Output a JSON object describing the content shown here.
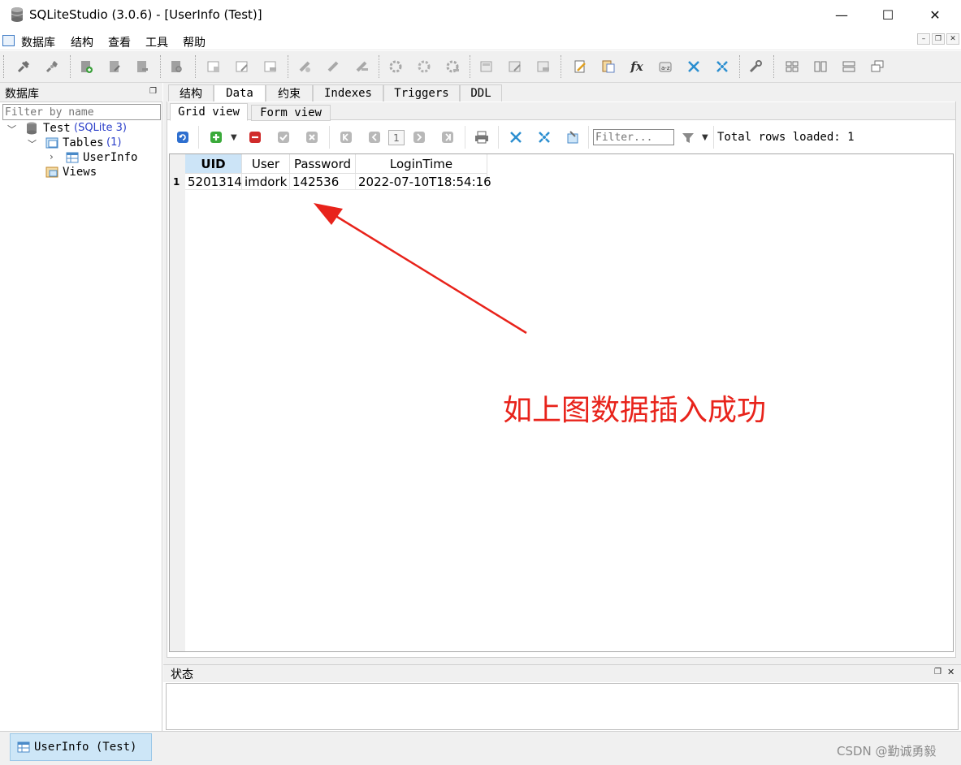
{
  "window": {
    "title": "SQLiteStudio (3.0.6) - [UserInfo (Test)]",
    "minimize": "—",
    "maximize": "☐",
    "close": "✕"
  },
  "menu": [
    "数据库",
    "结构",
    "查看",
    "工具",
    "帮助"
  ],
  "db_panel": {
    "title": "数据库",
    "filter_placeholder": "Filter by name",
    "tree": {
      "db_name": "Test",
      "db_type": "(SQLite 3)",
      "tables_label": "Tables",
      "tables_count": "(1)",
      "table_name": "UserInfo",
      "views_label": "Views"
    }
  },
  "tabs": [
    "结构",
    "Data",
    "约束",
    "Indexes",
    "Triggers",
    "DDL"
  ],
  "active_tab": "Data",
  "subtabs": [
    "Grid view",
    "Form view"
  ],
  "grid_toolbar": {
    "page_number": "1",
    "filter_placeholder": "Filter...",
    "total_rows": "Total rows loaded: 1"
  },
  "grid": {
    "columns": [
      "UID",
      "User",
      "Password",
      "LoginTime"
    ],
    "rows": [
      {
        "num": "1",
        "cells": [
          "5201314",
          "imdork",
          "142536",
          "2022-07-10T18:54:16"
        ]
      }
    ]
  },
  "annotation": {
    "text": "如上图数据插入成功",
    "color": "#e8231b"
  },
  "status_panel": {
    "title": "状态"
  },
  "taskbar": {
    "item": "UserInfo (Test)"
  },
  "watermark": "CSDN @勤诚勇毅"
}
